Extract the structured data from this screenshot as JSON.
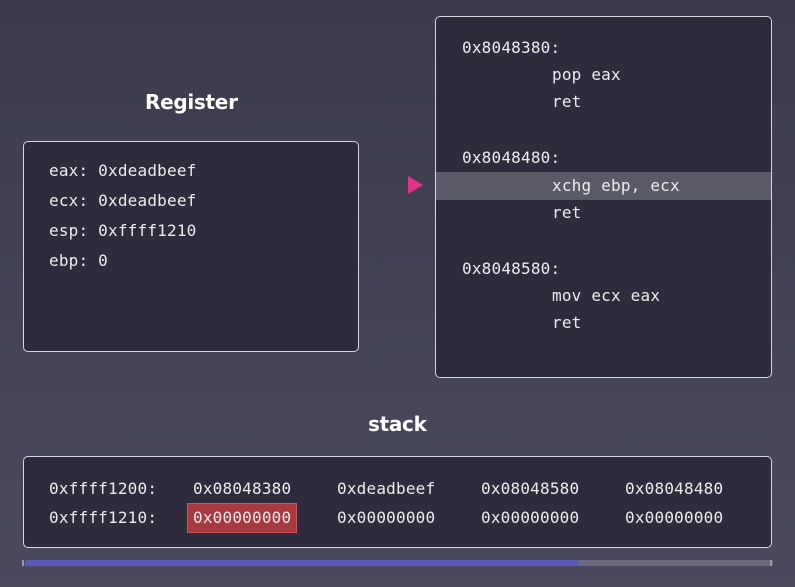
{
  "register": {
    "title": "Register",
    "lines": [
      "eax: 0xdeadbeef",
      "ecx: 0xdeadbeef",
      "esp: 0xffff1210",
      "ebp: 0"
    ]
  },
  "code": {
    "blocks": [
      {
        "address": "0x8048380:",
        "instructions": [
          "pop eax",
          "ret"
        ]
      },
      {
        "address": "0x8048480:",
        "instructions": [
          "xchg ebp, ecx",
          "ret"
        ]
      },
      {
        "address": "0x8048580:",
        "instructions": [
          "mov ecx eax",
          "ret"
        ]
      }
    ],
    "current_instruction": "xchg ebp, ecx"
  },
  "stack": {
    "title": "stack",
    "rows": [
      {
        "address": "0xffff1200:",
        "values": [
          "0x08048380",
          "0xdeadbeef",
          "0x08048580",
          "0x08048480"
        ]
      },
      {
        "address": "0xffff1210:",
        "values": [
          "0x00000000",
          "0x00000000",
          "0x00000000",
          "0x00000000"
        ]
      }
    ],
    "highlighted_value": "0x00000000"
  },
  "progress": {
    "fraction": 0.74
  },
  "colors": {
    "pointer": "#e0338a",
    "stack_highlight": "#a8393d",
    "progress_fill": "#5a59b8"
  }
}
